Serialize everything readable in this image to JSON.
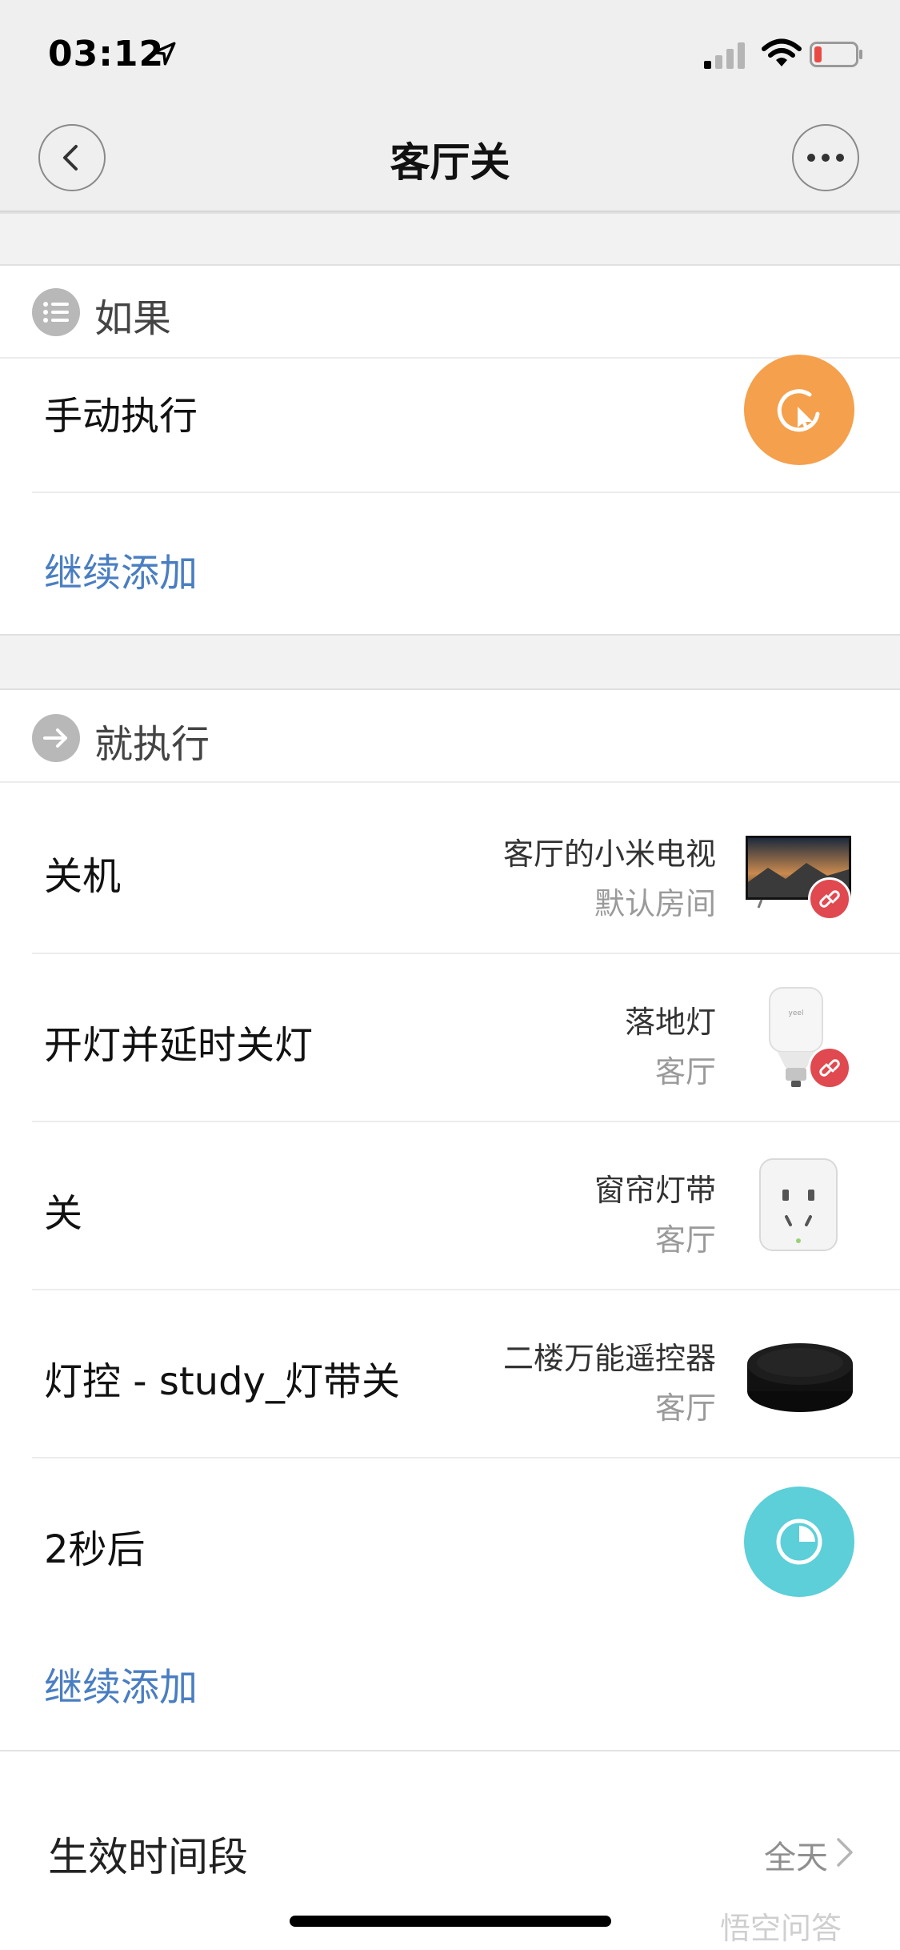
{
  "status_bar": {
    "time": "03:12"
  },
  "nav": {
    "title": "客厅关"
  },
  "if_section": {
    "label": "如果",
    "trigger": "手动执行",
    "add_label": "继续添加"
  },
  "then_section": {
    "label": "就执行",
    "actions": [
      {
        "title": "关机",
        "device": "客厅的小米电视",
        "room": "默认房间",
        "icon": "tv-icon",
        "offline_badge": true
      },
      {
        "title": "开灯并延时关灯",
        "device": "落地灯",
        "room": "客厅",
        "icon": "bulb-icon",
        "offline_badge": true
      },
      {
        "title": "关",
        "device": "窗帘灯带",
        "room": "客厅",
        "icon": "smart-plug-icon",
        "offline_badge": false
      },
      {
        "title": "灯控 - study_灯带关",
        "device": "二楼万能遥控器",
        "room": "客厅",
        "icon": "ir-remote-icon",
        "offline_badge": false
      }
    ],
    "delay": "2秒后",
    "add_label": "继续添加"
  },
  "effective_period": {
    "label": "生效时间段",
    "value": "全天"
  },
  "watermark": "悟空问答",
  "colors": {
    "accent_blue": "#4a7ec2",
    "manual_orange": "#f5a04c",
    "delay_teal": "#5ccfd8",
    "offline_red": "#e0494f",
    "battery_red": "#e94b44"
  }
}
